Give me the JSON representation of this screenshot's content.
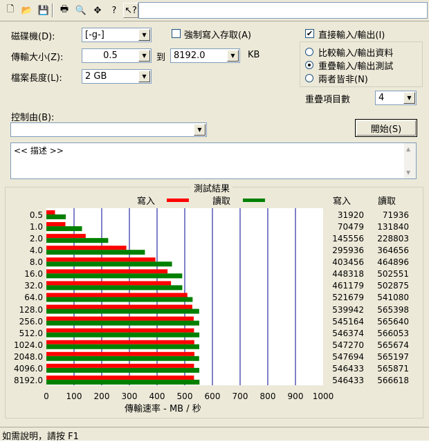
{
  "toolbar": {
    "icons": [
      "new-file-icon",
      "open-folder-icon",
      "save-icon",
      "print-icon",
      "print-preview-icon",
      "move-icon",
      "help-icon",
      "context-help-icon"
    ],
    "glyphs": [
      "🗋",
      "📂",
      "💾",
      "🖶",
      "🔍",
      "✥",
      "?",
      "↖?"
    ]
  },
  "drive": {
    "label": "磁碟機(D):",
    "value": "[-g-]"
  },
  "transfer": {
    "label": "傳輸大小(Z):",
    "from": "0.5",
    "to_label": "到",
    "to": "8192.0",
    "unit": "KB"
  },
  "filesize": {
    "label": "檔案長度(L):",
    "value": "2 GB"
  },
  "force_write": {
    "label": "強制寫入存取(A)",
    "checked": false
  },
  "direct_io": {
    "label": "直接輸入/輸出(I)",
    "checked": true
  },
  "mode": {
    "options": [
      {
        "label": "比較輸入/輸出資料",
        "selected": false
      },
      {
        "label": "重疊輸入/輸出測試",
        "selected": true
      },
      {
        "label": "兩者皆非(N)",
        "selected": false
      }
    ]
  },
  "queue": {
    "label": "重疊項目數",
    "value": "4"
  },
  "control": {
    "label": "控制由(B):",
    "value": ""
  },
  "start_button": "開始(S)",
  "description": "<< 描述 >>",
  "results": {
    "title": "測試結果",
    "write_label": "寫入",
    "read_label": "讀取",
    "col_write": "寫入",
    "col_read": "讀取"
  },
  "chart_data": {
    "type": "bar",
    "orientation": "horizontal",
    "title": "測試結果",
    "xlabel": "傳輸速率 - MB / 秒",
    "xlim": [
      0,
      1000
    ],
    "xticks": [
      "0",
      "100",
      "200",
      "300",
      "400",
      "500",
      "600",
      "700",
      "800",
      "900",
      "1000"
    ],
    "categories": [
      "0.5",
      "1.0",
      "2.0",
      "4.0",
      "8.0",
      "16.0",
      "32.0",
      "64.0",
      "128.0",
      "256.0",
      "512.0",
      "1024.0",
      "2048.0",
      "4096.0",
      "8192.0"
    ],
    "series": [
      {
        "name": "寫入",
        "color": "#ff0000",
        "values_kb": [
          "31920",
          "70479",
          "145556",
          "295936",
          "403456",
          "448318",
          "461179",
          "521679",
          "539942",
          "545164",
          "546374",
          "547270",
          "547694",
          "546433",
          "546433"
        ],
        "values": [
          31.2,
          68.8,
          142.1,
          289.0,
          394.0,
          437.8,
          450.4,
          509.5,
          527.3,
          532.4,
          533.6,
          534.4,
          534.9,
          533.6,
          533.6
        ]
      },
      {
        "name": "讀取",
        "color": "#008000",
        "values_kb": [
          "71936",
          "131840",
          "228803",
          "364656",
          "464896",
          "502551",
          "502875",
          "541080",
          "565398",
          "565640",
          "566053",
          "565674",
          "565197",
          "565871",
          "566618"
        ],
        "values": [
          70.3,
          128.8,
          223.4,
          356.1,
          454.0,
          490.8,
          491.1,
          528.4,
          552.1,
          552.4,
          552.8,
          552.4,
          552.0,
          552.6,
          553.3
        ]
      }
    ],
    "grid": true
  },
  "status": "如需說明，請按 F1"
}
